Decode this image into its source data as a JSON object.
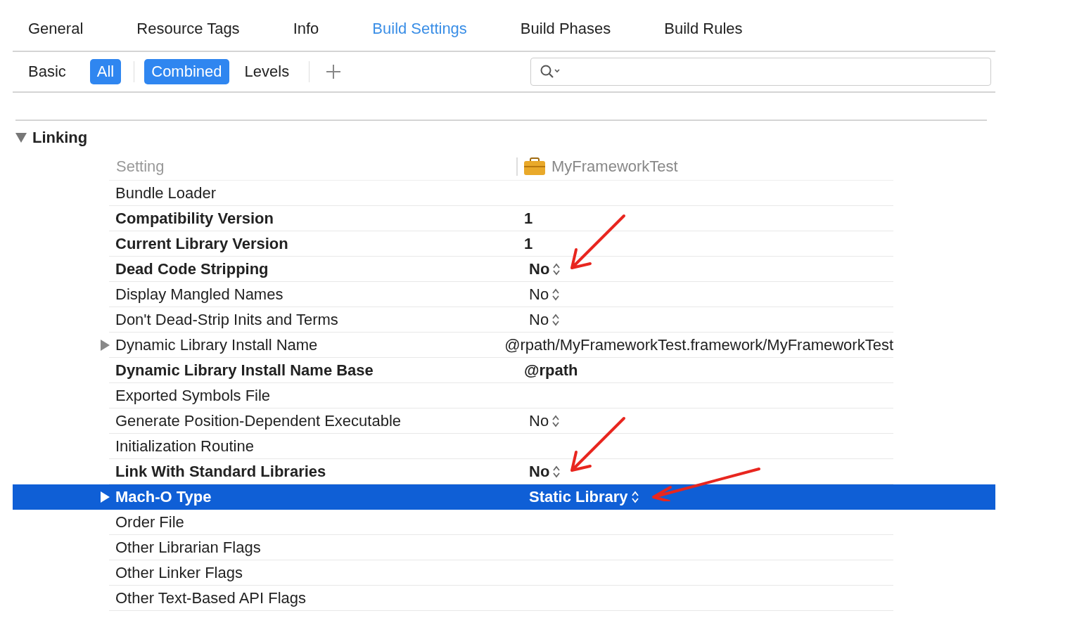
{
  "tabs": [
    {
      "label": "General",
      "selected": false
    },
    {
      "label": "Resource Tags",
      "selected": false
    },
    {
      "label": "Info",
      "selected": false
    },
    {
      "label": "Build Settings",
      "selected": true
    },
    {
      "label": "Build Phases",
      "selected": false
    },
    {
      "label": "Build Rules",
      "selected": false
    }
  ],
  "filters": [
    {
      "label": "Basic",
      "selected": false
    },
    {
      "label": "All",
      "selected": true
    }
  ],
  "views": [
    {
      "label": "Combined",
      "selected": true
    },
    {
      "label": "Levels",
      "selected": false
    }
  ],
  "section": {
    "title": "Linking",
    "expanded": true
  },
  "columns": {
    "setting": "Setting",
    "target": "MyFrameworkTest"
  },
  "rows": [
    {
      "name": "Bundle Loader",
      "value": "",
      "bold": false,
      "popup": false,
      "expandable": false,
      "selected": false,
      "arrow": false
    },
    {
      "name": "Compatibility Version",
      "value": "1",
      "bold": true,
      "popup": false,
      "expandable": false,
      "selected": false,
      "arrow": false
    },
    {
      "name": "Current Library Version",
      "value": "1",
      "bold": true,
      "popup": false,
      "expandable": false,
      "selected": false,
      "arrow": false
    },
    {
      "name": "Dead Code Stripping",
      "value": "No",
      "bold": true,
      "popup": true,
      "expandable": false,
      "selected": false,
      "arrow": true
    },
    {
      "name": "Display Mangled Names",
      "value": "No",
      "bold": false,
      "popup": true,
      "expandable": false,
      "selected": false,
      "arrow": false
    },
    {
      "name": "Don't Dead-Strip Inits and Terms",
      "value": "No",
      "bold": false,
      "popup": true,
      "expandable": false,
      "selected": false,
      "arrow": false
    },
    {
      "name": "Dynamic Library Install Name",
      "value": "@rpath/MyFrameworkTest.framework/MyFrameworkTest",
      "bold": false,
      "popup": false,
      "expandable": true,
      "selected": false,
      "arrow": false
    },
    {
      "name": "Dynamic Library Install Name Base",
      "value": "@rpath",
      "bold": true,
      "popup": false,
      "expandable": false,
      "selected": false,
      "arrow": false
    },
    {
      "name": "Exported Symbols File",
      "value": "",
      "bold": false,
      "popup": false,
      "expandable": false,
      "selected": false,
      "arrow": false
    },
    {
      "name": "Generate Position-Dependent Executable",
      "value": "No",
      "bold": false,
      "popup": true,
      "expandable": false,
      "selected": false,
      "arrow": false
    },
    {
      "name": "Initialization Routine",
      "value": "",
      "bold": false,
      "popup": false,
      "expandable": false,
      "selected": false,
      "arrow": false
    },
    {
      "name": "Link With Standard Libraries",
      "value": "No",
      "bold": true,
      "popup": true,
      "expandable": false,
      "selected": false,
      "arrow": true
    },
    {
      "name": "Mach-O Type",
      "value": "Static Library",
      "bold": true,
      "popup": true,
      "expandable": true,
      "selected": true,
      "arrow": true
    },
    {
      "name": "Order File",
      "value": "",
      "bold": false,
      "popup": false,
      "expandable": false,
      "selected": false,
      "arrow": false
    },
    {
      "name": "Other Librarian Flags",
      "value": "",
      "bold": false,
      "popup": false,
      "expandable": false,
      "selected": false,
      "arrow": false
    },
    {
      "name": "Other Linker Flags",
      "value": "",
      "bold": false,
      "popup": false,
      "expandable": false,
      "selected": false,
      "arrow": false
    },
    {
      "name": "Other Text-Based API Flags",
      "value": "",
      "bold": false,
      "popup": false,
      "expandable": false,
      "selected": false,
      "arrow": false
    }
  ]
}
